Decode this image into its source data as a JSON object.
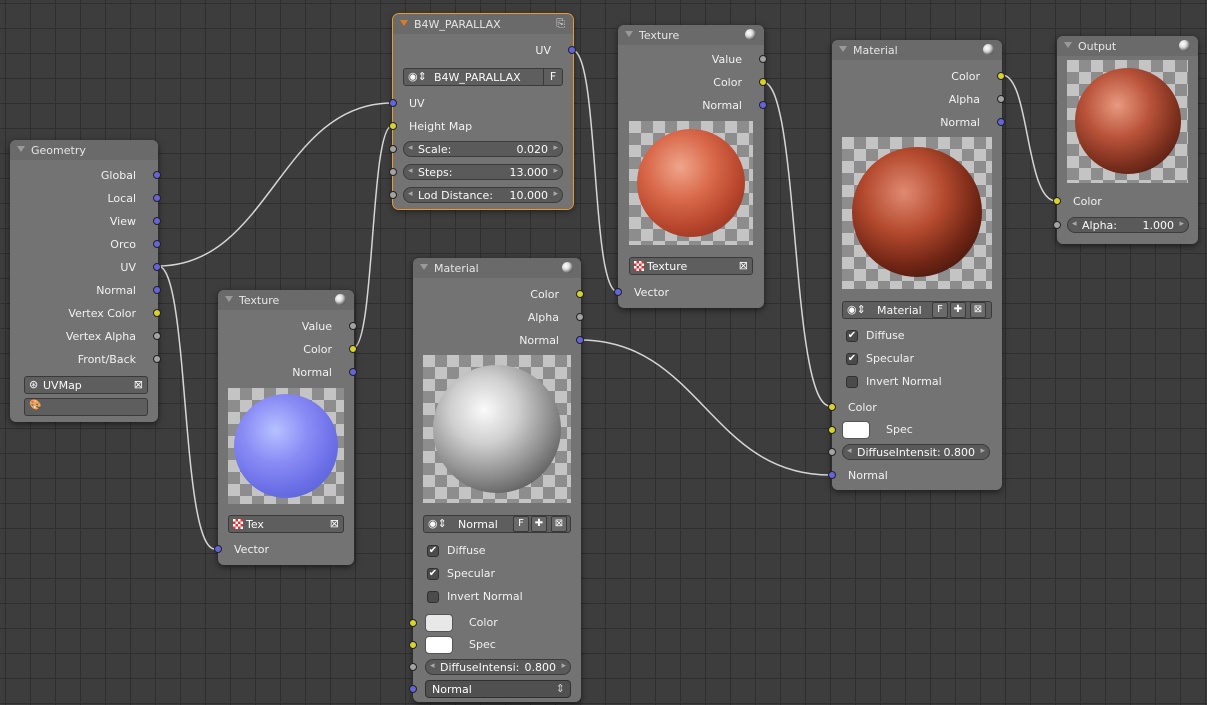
{
  "geometry": {
    "title": "Geometry",
    "outputs": [
      "Global",
      "Local",
      "View",
      "Orco",
      "UV",
      "Normal",
      "Vertex Color",
      "Vertex Alpha",
      "Front/Back"
    ],
    "uvmap": "UVMap"
  },
  "parallax": {
    "title": "B4W_PARALLAX",
    "out_uv": "UV",
    "group_name": "B4W_PARALLAX",
    "fake_user": "F",
    "in_uv": "UV",
    "in_height": "Height Map",
    "scale_label": "Scale:",
    "scale_value": "0.020",
    "steps_label": "Steps:",
    "steps_value": "13.000",
    "lod_label": "Lod Distance:",
    "lod_value": "10.000"
  },
  "texture_top": {
    "title": "Texture",
    "out_value": "Value",
    "out_color": "Color",
    "out_normal": "Normal",
    "tex_name": "Texture",
    "in_vector": "Vector"
  },
  "texture_left": {
    "title": "Texture",
    "out_value": "Value",
    "out_color": "Color",
    "out_normal": "Normal",
    "tex_name": "Tex",
    "in_vector": "Vector"
  },
  "material_mid": {
    "title": "Material",
    "out_color": "Color",
    "out_alpha": "Alpha",
    "out_normal": "Normal",
    "mat_name": "Normal",
    "fake_user": "F",
    "diffuse": "Diffuse",
    "specular": "Specular",
    "invert_normal": "Invert Normal",
    "in_color": "Color",
    "in_spec": "Spec",
    "diff_label": "DiffuseIntensi:",
    "diff_value": "0.800",
    "normal_dropdown": "Normal"
  },
  "material_right": {
    "title": "Material",
    "out_color": "Color",
    "out_alpha": "Alpha",
    "out_normal": "Normal",
    "mat_name": "Material",
    "fake_user": "F",
    "diffuse": "Diffuse",
    "specular": "Specular",
    "invert_normal": "Invert Normal",
    "in_color": "Color",
    "in_spec": "Spec",
    "diff_label": "DiffuseIntensit:",
    "diff_value": "0.800",
    "in_normal": "Normal"
  },
  "output": {
    "title": "Output",
    "in_color": "Color",
    "alpha_label": "Alpha:",
    "alpha_value": "1.000"
  },
  "colors": {
    "socket_vector": "#6464dc",
    "socket_color": "#d8d32c",
    "socket_value": "#a3a3a3",
    "active_outline": "#e29a3c"
  }
}
